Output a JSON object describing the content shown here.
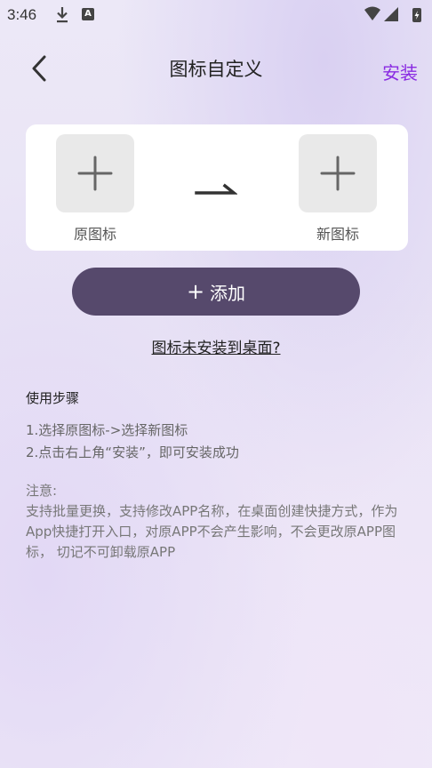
{
  "status_bar": {
    "time": "3:46",
    "download_icon": "download-icon",
    "a_icon_label": "A"
  },
  "header": {
    "title": "图标自定义",
    "install_label": "安装",
    "install_color": "#8a2be2"
  },
  "icon_card": {
    "original_label": "原图标",
    "new_label": "新图标"
  },
  "add_button": {
    "plus": "+",
    "label": "添加",
    "color": "#56496c"
  },
  "not_installed_link": "图标未安装到桌面?",
  "steps": {
    "title": "使用步骤",
    "step1": "1.选择原图标->选择新图标",
    "step2": "2.点击右上角“安装”，即可安装成功"
  },
  "note": {
    "title": "注意:",
    "body": "支持批量更换，支持修改APP名称，在桌面创建快捷方式，作为 App快捷打开入口，对原APP不会产生影响，不会更改原APP图标， 切记不可卸载原APP"
  }
}
